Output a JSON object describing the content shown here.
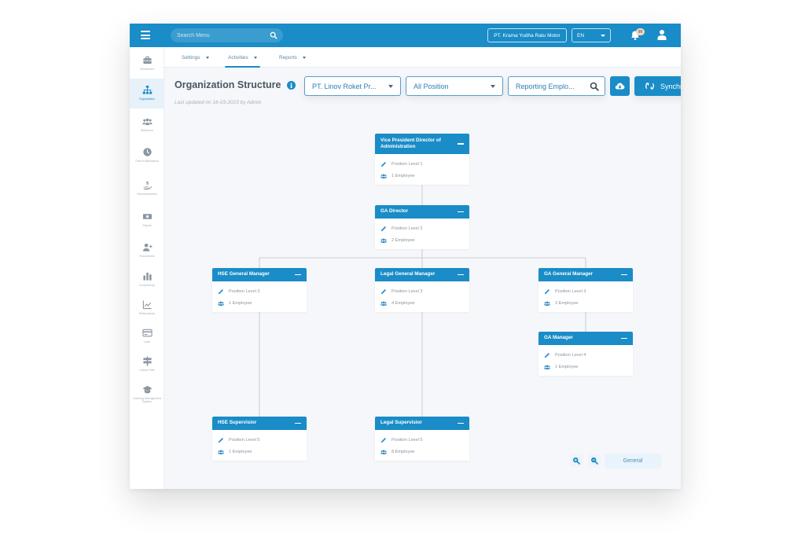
{
  "topbar": {
    "search_placeholder": "Search Menu",
    "company": "PT. Krama Yudha Ratu Motor",
    "language": "EN",
    "notification_count": "99",
    "brand_color": "#1a8cc7"
  },
  "sidebar": {
    "items": [
      {
        "label": "Workboard",
        "icon": "briefcase-icon",
        "active": false
      },
      {
        "label": "Organization",
        "icon": "org-chart-icon",
        "active": true
      },
      {
        "label": "Workforce",
        "icon": "users-icon",
        "active": false
      },
      {
        "label": "Time & Attendance",
        "icon": "clock-icon",
        "active": false
      },
      {
        "label": "Reimbursement",
        "icon": "hand-dollar-icon",
        "active": false
      },
      {
        "label": "Payroll",
        "icon": "money-icon",
        "active": false
      },
      {
        "label": "Recruitment",
        "icon": "user-plus-icon",
        "active": false
      },
      {
        "label": "Competency",
        "icon": "bar-chart-icon",
        "active": false
      },
      {
        "label": "Performance",
        "icon": "line-chart-icon",
        "active": false
      },
      {
        "label": "Loan",
        "icon": "card-icon",
        "active": false
      },
      {
        "label": "Career Path",
        "icon": "signpost-icon",
        "active": false
      },
      {
        "label": "Learning Management System",
        "icon": "graduation-cap-icon",
        "active": false
      }
    ]
  },
  "subnav": {
    "tabs": [
      {
        "label": "Settings",
        "active": false
      },
      {
        "label": "Activities",
        "active": true
      },
      {
        "label": "Reports",
        "active": false
      }
    ]
  },
  "header": {
    "title": "Organization Structure",
    "last_updated": "Last updated on 16-03-2023 by Admin",
    "company_select": "PT. Linov Roket Pr...",
    "position_select": "All Position",
    "employee_search_placeholder": "Reporting Emplo...",
    "sync_label": "Synchronization"
  },
  "org_chart": {
    "nodes": [
      {
        "id": "vp",
        "title": "Vice President Director of Administration",
        "level": "Position Level 1",
        "employees": "1 Employee"
      },
      {
        "id": "gad",
        "title": "GA Director",
        "level": "Position Level 2",
        "employees": "2 Employee"
      },
      {
        "id": "hsegm",
        "title": "HSE General Manager",
        "level": "Position Level 3",
        "employees": "1 Employee"
      },
      {
        "id": "leggm",
        "title": "Legal General Manager",
        "level": "Position Level 3",
        "employees": "4 Employee"
      },
      {
        "id": "gagm",
        "title": "GA General Manager",
        "level": "Position Level 3",
        "employees": "3 Employee"
      },
      {
        "id": "gam",
        "title": "GA Manager",
        "level": "Position Level 4",
        "employees": "1 Employee"
      },
      {
        "id": "hsesup",
        "title": "HSE Supervisior",
        "level": "Position Level 5",
        "employees": "1 Employee"
      },
      {
        "id": "legsup",
        "title": "Legal Supervisior",
        "level": "Position Level 5",
        "employees": "8 Employee"
      }
    ],
    "edges": [
      [
        "vp",
        "gad"
      ],
      [
        "gad",
        "hsegm"
      ],
      [
        "gad",
        "leggm"
      ],
      [
        "gad",
        "gagm"
      ],
      [
        "gagm",
        "gam"
      ],
      [
        "hsegm",
        "hsesup"
      ],
      [
        "leggm",
        "legsup"
      ]
    ]
  },
  "footer_controls": {
    "view_mode": "General"
  }
}
